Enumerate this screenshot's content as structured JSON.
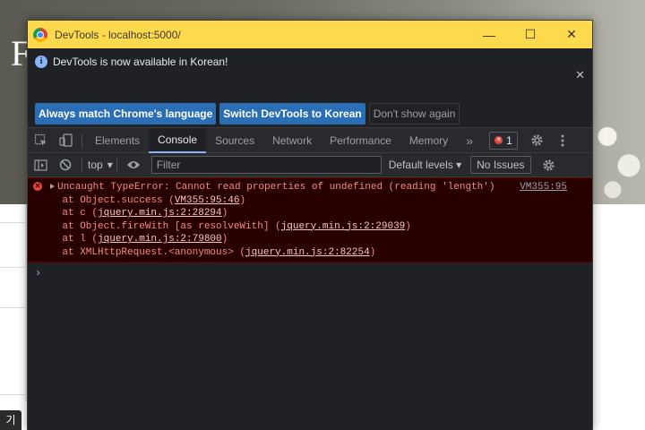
{
  "background_page": {
    "heading_letter": "F",
    "dark_button_label": "기"
  },
  "window": {
    "title": "DevTools - localhost:5000/",
    "controls": {
      "minimize": "—",
      "maximize": "☐",
      "close": "✕"
    }
  },
  "infobar": {
    "icon": "i",
    "message": "DevTools is now available in Korean!",
    "close": "✕",
    "buttons": [
      "Always match Chrome's language",
      "Switch DevTools to Korean",
      "Don't show again"
    ]
  },
  "tabs": {
    "items": [
      "Elements",
      "Console",
      "Sources",
      "Network",
      "Performance",
      "Memory"
    ],
    "active": "Console",
    "more": "»",
    "error_count": "1"
  },
  "console_toolbar": {
    "context": "top",
    "filter_placeholder": "Filter",
    "levels": "Default levels",
    "issues": "No Issues"
  },
  "console": {
    "error_message": "Uncaught TypeError: Cannot read properties of undefined (reading 'length')",
    "source": "VM355:95",
    "stack": [
      {
        "prefix": "    at Object.success (",
        "link": "VM355:95:46",
        "suffix": ")"
      },
      {
        "prefix": "    at c (",
        "link": "jquery.min.js:2:28294",
        "suffix": ")"
      },
      {
        "prefix": "    at Object.fireWith [as resolveWith] (",
        "link": "jquery.min.js:2:29039",
        "suffix": ")"
      },
      {
        "prefix": "    at l (",
        "link": "jquery.min.js:2:79800",
        "suffix": ")"
      },
      {
        "prefix": "    at XMLHttpRequest.<anonymous> (",
        "link": "jquery.min.js:2:82254",
        "suffix": ")"
      }
    ],
    "prompt": "›"
  }
}
